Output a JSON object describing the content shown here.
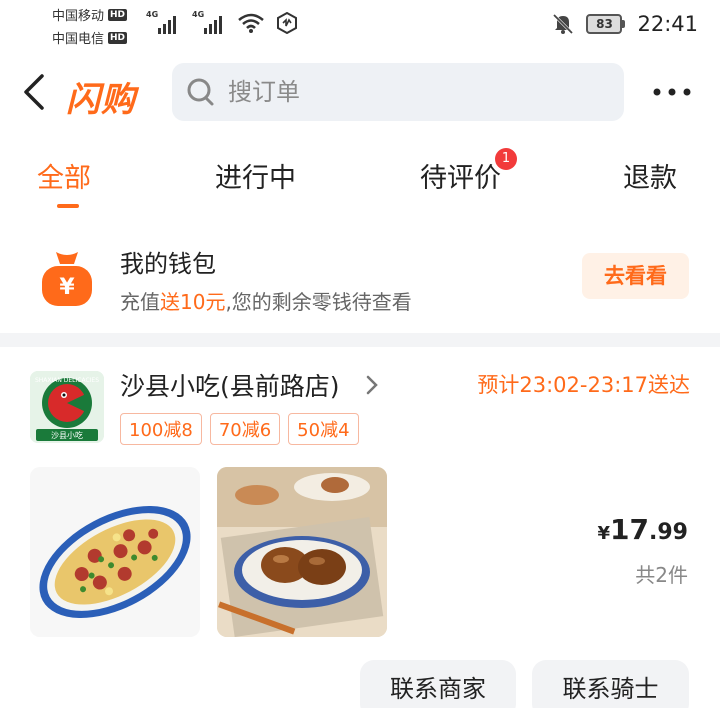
{
  "status_bar": {
    "carrier1": "中国移动",
    "carrier2": "中国电信",
    "hd_badge": "HD",
    "network_type": "4G",
    "battery": "83",
    "time": "22:41"
  },
  "header": {
    "logo": "闪购",
    "search_placeholder": "搜订单",
    "back_icon": "back-arrow-icon",
    "more_icon": "more-icon"
  },
  "tabs": [
    {
      "label": "全部",
      "active": true
    },
    {
      "label": "进行中",
      "active": false
    },
    {
      "label": "待评价",
      "badge": "1"
    },
    {
      "label": "退款",
      "active": false
    }
  ],
  "wallet": {
    "title": "我的钱包",
    "sub_prefix": "充值",
    "sub_highlight": "送10元",
    "sub_suffix": ",您的剩余零钱待查看",
    "button": "去看看",
    "icon_symbol": "¥"
  },
  "order": {
    "shop_name": "沙县小吃(县前路店)",
    "shop_logo_text": "沙县小吃",
    "shop_logo_arc": "SHAXIAN DELICACIES",
    "eta": "预计23:02-23:17送达",
    "coupons": [
      "100减8",
      "70减6",
      "50减4"
    ],
    "price_currency": "¥",
    "price_integer": "17",
    "price_decimal": ".99",
    "item_count": "共2件",
    "buttons": {
      "contact_shop": "联系商家",
      "contact_rider": "联系骑士"
    }
  },
  "colors": {
    "accent": "#ff6a1a",
    "badge": "#f23b3b",
    "bg_gray": "#f3f4f6"
  }
}
